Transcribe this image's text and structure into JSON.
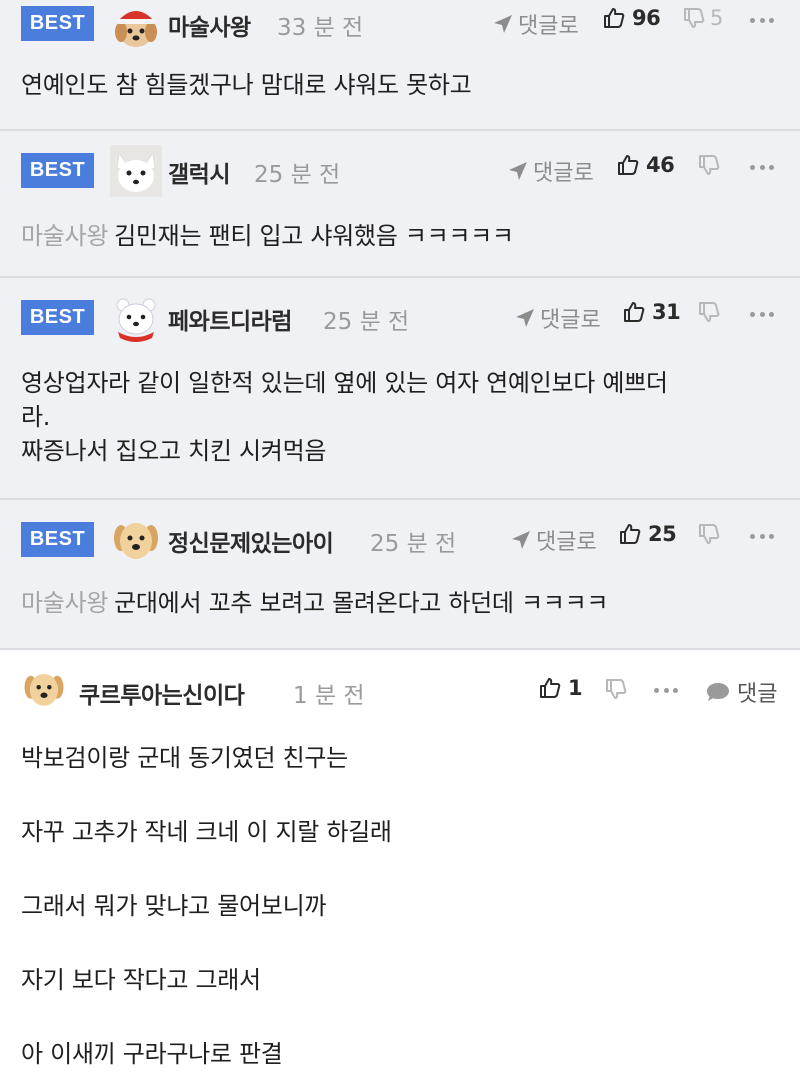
{
  "best_comments": [
    {
      "badge": "BEST",
      "avatar_icon": "red-hat-dog-avatar-icon",
      "nickname": "마술사왕",
      "time": "33 분 전",
      "reply_label": "댓글로",
      "upvotes": "96",
      "downvotes": "5",
      "mention": "",
      "text": "연예인도 참 힘들겠구나 맘대로 샤워도 못하고"
    },
    {
      "badge": "BEST",
      "avatar_icon": "white-fox-avatar-icon",
      "nickname": "갤럭시",
      "time": "25 분 전",
      "reply_label": "댓글로",
      "upvotes": "46",
      "downvotes": "",
      "mention": "마술사왕",
      "text": "김민재는 팬티 입고 샤워했음 ㅋㅋㅋㅋㅋ"
    },
    {
      "badge": "BEST",
      "avatar_icon": "polar-bear-avatar-icon",
      "nickname": "페와트디라럼",
      "time": "25 분 전",
      "reply_label": "댓글로",
      "upvotes": "31",
      "downvotes": "",
      "mention": "",
      "text_lines": [
        "영상업자라 같이 일한적 있는데 옆에 있는 여자 연예인보다 예쁘더",
        "라.",
        "짜증나서 집오고 치킨 시켜먹음"
      ]
    },
    {
      "badge": "BEST",
      "avatar_icon": "puppy-avatar-icon",
      "nickname": "정신문제있는아이",
      "time": "25 분 전",
      "reply_label": "댓글로",
      "upvotes": "25",
      "downvotes": "",
      "mention": "마술사왕",
      "text": "군대에서 꼬추 보려고 몰려온다고 하던데 ㅋㅋㅋㅋ"
    }
  ],
  "comment": {
    "avatar_icon": "puppy-avatar-icon",
    "nickname": "쿠르투아는신이다",
    "time": "1 분 전",
    "upvotes": "1",
    "chat_label": "댓글",
    "lines": [
      "박보검이랑 군대 동기였던 친구는",
      "자꾸 고추가 작네 크네 이 지랄 하길래",
      "그래서 뭐가 맞냐고 물어보니까",
      "자기 보다 작다고 그래서",
      "아 이새끼 구라구나로 판결"
    ]
  },
  "colors": {
    "best_badge": "#4a7ddc",
    "best_background": "#f0f1f4",
    "mention_gray": "#a5a5a5"
  }
}
